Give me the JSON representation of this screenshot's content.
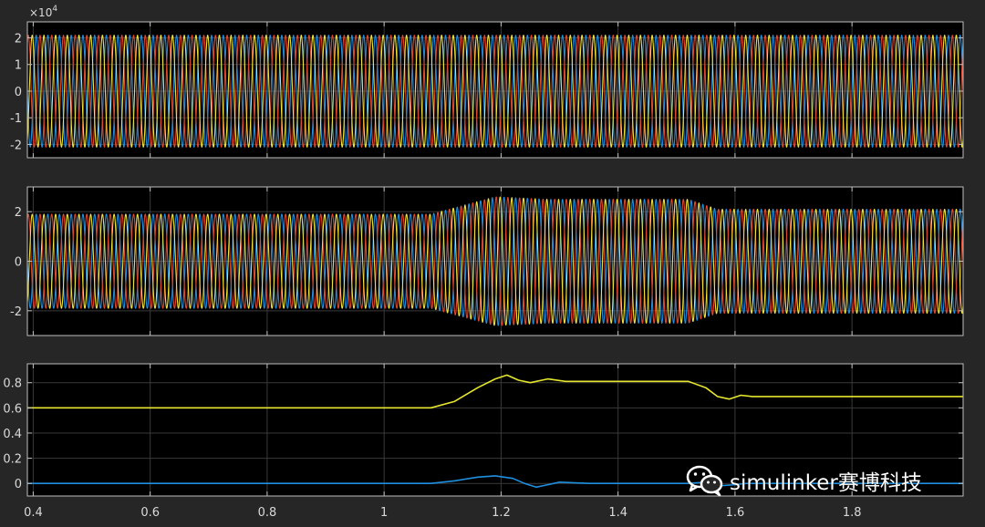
{
  "colors": {
    "background": "#262626",
    "axes_bg": "#000000",
    "grid": "#3a3a3a",
    "frame": "#bfbfbf",
    "tick_text": "#d9d9d9",
    "phase_a": "#f2e33a",
    "phase_b": "#1f8fe0",
    "phase_c": "#e0472b",
    "ctrl_yellow": "#e6e62e",
    "ctrl_blue": "#1f8fe0"
  },
  "chart_data": [
    {
      "type": "line",
      "panel": "top",
      "exponent_label": "×10",
      "exponent_power": "4",
      "x": {
        "min": 0.39,
        "max": 1.99,
        "ticks": [
          0.4,
          0.6,
          0.8,
          1,
          1.2,
          1.4,
          1.6,
          1.8
        ]
      },
      "ylim": [
        -2.5,
        2.6
      ],
      "y_ticks": [
        -2,
        -1,
        0,
        1,
        2
      ],
      "y_tick_labels": [
        "-2",
        "-1",
        "0",
        "1",
        "2"
      ],
      "grid": true,
      "series": [
        {
          "color_key": "phase_b",
          "phase_deg": 0
        },
        {
          "color_key": "phase_c",
          "phase_deg": 120
        },
        {
          "color_key": "phase_a",
          "phase_deg": 240
        }
      ],
      "frequency_hz": 50,
      "amplitude_profile": [
        [
          0.39,
          2.1
        ],
        [
          1.99,
          2.1
        ]
      ]
    },
    {
      "type": "line",
      "panel": "middle",
      "x": {
        "min": 0.39,
        "max": 1.99,
        "ticks": [
          0.4,
          0.6,
          0.8,
          1,
          1.2,
          1.4,
          1.6,
          1.8
        ]
      },
      "ylim": [
        -3,
        3
      ],
      "y_ticks": [
        -2,
        0,
        2
      ],
      "y_tick_labels": [
        "-2",
        "0",
        "2"
      ],
      "grid": true,
      "series": [
        {
          "color_key": "phase_b",
          "phase_deg": 0
        },
        {
          "color_key": "phase_c",
          "phase_deg": 120
        },
        {
          "color_key": "phase_a",
          "phase_deg": 240
        }
      ],
      "frequency_hz": 50,
      "amplitude_profile": [
        [
          0.39,
          1.9
        ],
        [
          1.08,
          1.9
        ],
        [
          1.19,
          2.6
        ],
        [
          1.28,
          2.5
        ],
        [
          1.52,
          2.5
        ],
        [
          1.57,
          2.1
        ],
        [
          1.99,
          2.1
        ]
      ]
    },
    {
      "type": "line",
      "panel": "bottom",
      "x": {
        "min": 0.39,
        "max": 1.99,
        "ticks": [
          0.4,
          0.6,
          0.8,
          1,
          1.2,
          1.4,
          1.6,
          1.8
        ],
        "tick_labels": [
          "0.4",
          "0.6",
          "0.8",
          "1",
          "1.2",
          "1.4",
          "1.6",
          "1.8"
        ]
      },
      "ylim": [
        -0.1,
        0.95
      ],
      "y_ticks": [
        0,
        0.2,
        0.4,
        0.6,
        0.8
      ],
      "y_tick_labels": [
        "0",
        "0.2",
        "0.4",
        "0.6",
        "0.8"
      ],
      "grid": true,
      "series": [
        {
          "color_key": "ctrl_yellow",
          "points": [
            [
              0.39,
              0.6
            ],
            [
              1.08,
              0.6
            ],
            [
              1.12,
              0.65
            ],
            [
              1.16,
              0.76
            ],
            [
              1.19,
              0.83
            ],
            [
              1.21,
              0.86
            ],
            [
              1.23,
              0.82
            ],
            [
              1.25,
              0.8
            ],
            [
              1.28,
              0.83
            ],
            [
              1.31,
              0.81
            ],
            [
              1.35,
              0.81
            ],
            [
              1.4,
              0.81
            ],
            [
              1.52,
              0.81
            ],
            [
              1.55,
              0.76
            ],
            [
              1.57,
              0.69
            ],
            [
              1.59,
              0.67
            ],
            [
              1.61,
              0.7
            ],
            [
              1.63,
              0.69
            ],
            [
              1.65,
              0.69
            ],
            [
              1.99,
              0.69
            ]
          ]
        },
        {
          "color_key": "ctrl_blue",
          "points": [
            [
              0.39,
              0.0
            ],
            [
              1.08,
              0.0
            ],
            [
              1.12,
              0.02
            ],
            [
              1.16,
              0.05
            ],
            [
              1.19,
              0.06
            ],
            [
              1.22,
              0.04
            ],
            [
              1.24,
              0.0
            ],
            [
              1.26,
              -0.03
            ],
            [
              1.28,
              -0.01
            ],
            [
              1.3,
              0.01
            ],
            [
              1.35,
              0.0
            ],
            [
              1.45,
              0.0
            ],
            [
              1.52,
              0.0
            ],
            [
              1.55,
              0.01
            ],
            [
              1.57,
              -0.02
            ],
            [
              1.6,
              -0.01
            ],
            [
              1.62,
              0.0
            ],
            [
              1.99,
              0.0
            ]
          ]
        }
      ]
    }
  ],
  "watermark": {
    "text": "simulinker赛博科技",
    "icon": "wechat-icon"
  }
}
